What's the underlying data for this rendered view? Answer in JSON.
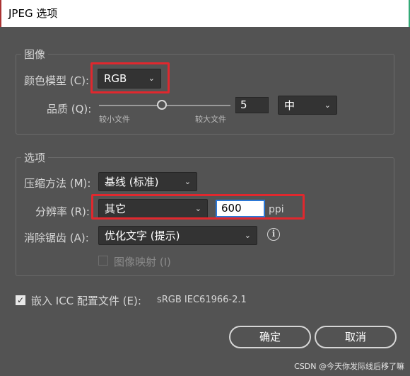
{
  "window": {
    "title": "JPEG 选项"
  },
  "image_group": {
    "title": "图像",
    "color_model_label": "颜色模型 (C):",
    "color_model_value": "RGB",
    "quality_label": "品质 (Q):",
    "quality_value": "5",
    "quality_level": "中",
    "slider_min_label": "较小文件",
    "slider_max_label": "较大文件",
    "slider_position": 0.5
  },
  "options_group": {
    "title": "选项",
    "compression_label": "压缩方法 (M):",
    "compression_value": "基线 (标准)",
    "resolution_label": "分辨率 (R):",
    "resolution_value": "其它",
    "resolution_number": "600",
    "resolution_unit": "ppi",
    "antialias_label": "消除锯齿 (A):",
    "antialias_value": "优化文字 (提示)",
    "imagemap_label": "图像映射 (I)"
  },
  "embed_icc": {
    "label": "嵌入 ICC 配置文件 (E):",
    "profile": "sRGB IEC61966-2.1",
    "checked": true
  },
  "buttons": {
    "ok": "确定",
    "cancel": "取消"
  },
  "watermark": "CSDN @今天你发际线后移了嘛"
}
